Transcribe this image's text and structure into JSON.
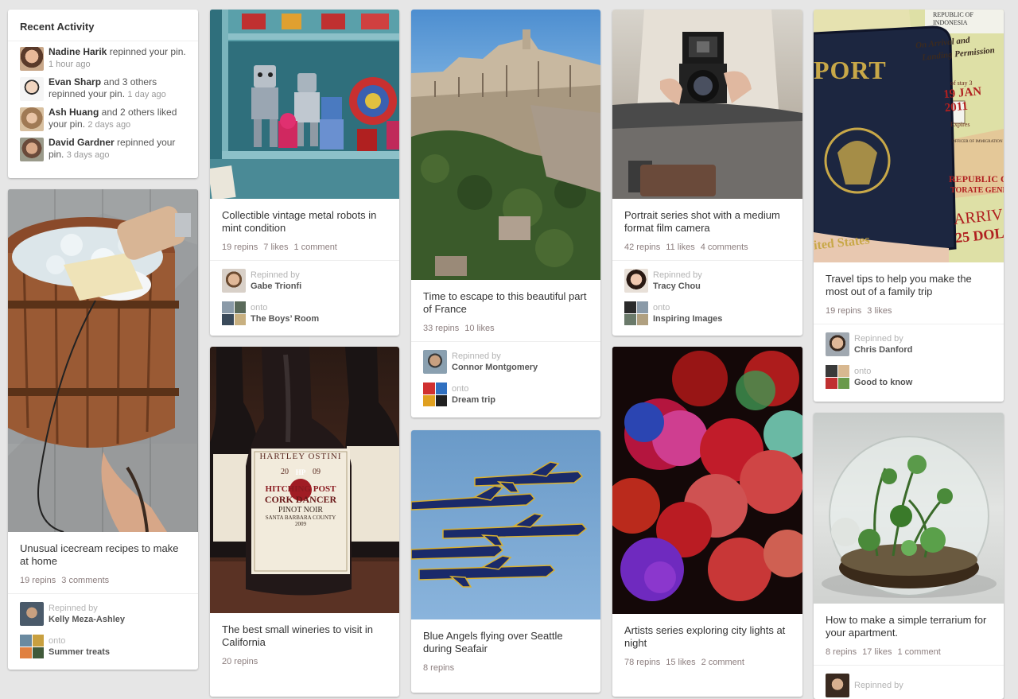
{
  "recent_activity": {
    "title": "Recent Activity",
    "items": [
      {
        "name": "Nadine Harik",
        "action": " repinned your pin. ",
        "time": "1 hour ago"
      },
      {
        "name": "Evan Sharp",
        "action": " and 3 others repinned your pin. ",
        "time": "1 day ago"
      },
      {
        "name": "Ash Huang",
        "action": " and 2 others liked your pin. ",
        "time": "2 days ago"
      },
      {
        "name": "David Gardner",
        "action": " repinned your pin. ",
        "time": "3 days ago"
      }
    ]
  },
  "pins": {
    "icecream": {
      "description": "Unusual icecream recipes to make at home",
      "stats": [
        "19 repins",
        "3 comments"
      ],
      "repinned_label": "Repinned by",
      "repinned_by": "Kelly Meza-Ashley",
      "onto_label": "onto",
      "board": "Summer treats"
    },
    "robots": {
      "description": "Collectible vintage metal robots in mint condition",
      "stats": [
        "19 repins",
        "7 likes",
        "1 comment"
      ],
      "repinned_label": "Repinned by",
      "repinned_by": "Gabe Trionfi",
      "onto_label": "onto",
      "board": "The Boys’ Room"
    },
    "wine": {
      "description": "The best small wineries to visit in California",
      "stats": [
        "20 repins"
      ],
      "label_brand": "HARTLEY OSTINI",
      "label_year_left": "20",
      "label_year_right": "09",
      "label_logo": "HP",
      "label_line1": "HITCHING POST",
      "label_line2": "CORK DANCER",
      "label_line3": "PINOT NOIR",
      "label_line4": "SANTA BARBARA COUNTY",
      "label_line5": "2009"
    },
    "france": {
      "description": "Time to escape to this beautiful part of France",
      "stats": [
        "33 repins",
        "10 likes"
      ],
      "repinned_label": "Repinned by",
      "repinned_by": "Connor Montgomery",
      "onto_label": "onto",
      "board": "Dream trip"
    },
    "jets": {
      "description": "Blue Angels flying over Seattle during Seafair",
      "stats": [
        "8 repins"
      ]
    },
    "camera": {
      "description": "Portrait series shot with a medium format film camera",
      "stats": [
        "42 repins",
        "11 likes",
        "4 comments"
      ],
      "repinned_label": "Repinned by",
      "repinned_by": "Tracy Chou",
      "onto_label": "onto",
      "board": "Inspiring Images"
    },
    "bokeh": {
      "description": "Artists series exploring city lights at night",
      "stats": [
        "78 repins",
        "15 likes",
        "2 comment"
      ]
    },
    "passport": {
      "description": "Travel tips to help you make the most out of a family trip",
      "stats": [
        "19 repins",
        "3 likes"
      ],
      "repinned_label": "Repinned by",
      "repinned_by": "Chris Danford",
      "onto_label": "onto",
      "board": "Good to know",
      "img_text_1": "PORT",
      "img_text_2": "On Arrival and",
      "img_text_3": "Landing Permission",
      "img_text_4": "REPUBLIC OF",
      "img_text_5": "INDONESIA",
      "img_text_6": "19 JAN 2011",
      "img_text_7": "REPUBLIC OF K",
      "img_text_8": "TORATE GENERA",
      "img_text_9": "ARRIV",
      "img_text_10": "25 DOL",
      "img_text_11": "ited States",
      "img_text_12": "of stay 3",
      "img_text_13": "Expires",
      "img_text_14": "OFFICER OF IMMIGRATION"
    },
    "terrarium": {
      "description": "How to make a simple terrarium for your apartment.",
      "stats": [
        "8 repins",
        "17 likes",
        "1 comment"
      ],
      "repinned_label": "Repinned by"
    }
  }
}
